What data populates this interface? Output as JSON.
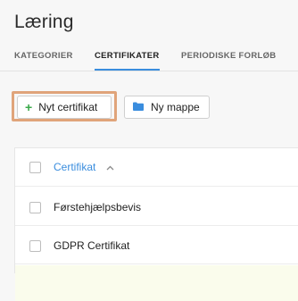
{
  "page": {
    "title": "Læring"
  },
  "tabs": [
    {
      "label": "KATEGORIER"
    },
    {
      "label": "CERTIFIKATER"
    },
    {
      "label": "PERIODISKE FORLØB"
    }
  ],
  "toolbar": {
    "new_label": "Nyt certifikat",
    "new_icon": "plus-icon",
    "folder_label": "Ny mappe",
    "folder_icon": "folder-icon"
  },
  "table": {
    "header": "Certifikat",
    "sort_icon": "chevron-up-icon",
    "rows": [
      {
        "name": "Førstehjælpsbevis"
      },
      {
        "name": "GDPR Certifikat"
      }
    ]
  },
  "colors": {
    "accent": "#3a8dde",
    "highlight_border": "#e0a47a",
    "plus": "#3aa94a"
  }
}
